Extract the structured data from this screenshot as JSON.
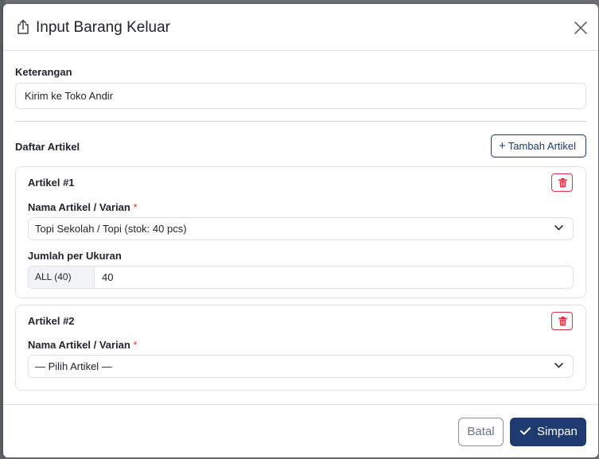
{
  "modal": {
    "title": "Input Barang Keluar",
    "keterangan_label": "Keterangan",
    "keterangan_value": "Kirim ke Toko Andir",
    "daftar_label": "Daftar Artikel",
    "add_button_label": "Tambah Artikel",
    "articles": [
      {
        "title": "Artikel #1",
        "name_label": "Nama Artikel / Varian",
        "required_mark": "*",
        "selected": "Topi Sekolah / Topi (stok: 40 pcs)",
        "qty_label": "Jumlah per Ukuran",
        "size_addon": "ALL (40)",
        "qty_value": "40"
      },
      {
        "title": "Artikel #2",
        "name_label": "Nama Artikel / Varian",
        "required_mark": "*",
        "selected": "— Pilih Artikel —"
      }
    ],
    "cancel_label": "Batal",
    "save_label": "Simpan"
  },
  "icons": {
    "header": "share-icon",
    "close": "close-icon",
    "delete": "trash-icon",
    "dropdown": "chevron-down-icon",
    "save": "check-icon",
    "add": "plus-icon"
  },
  "colors": {
    "primary": "#1e3a6e",
    "danger": "#dc3545",
    "border": "#dee2e6"
  }
}
